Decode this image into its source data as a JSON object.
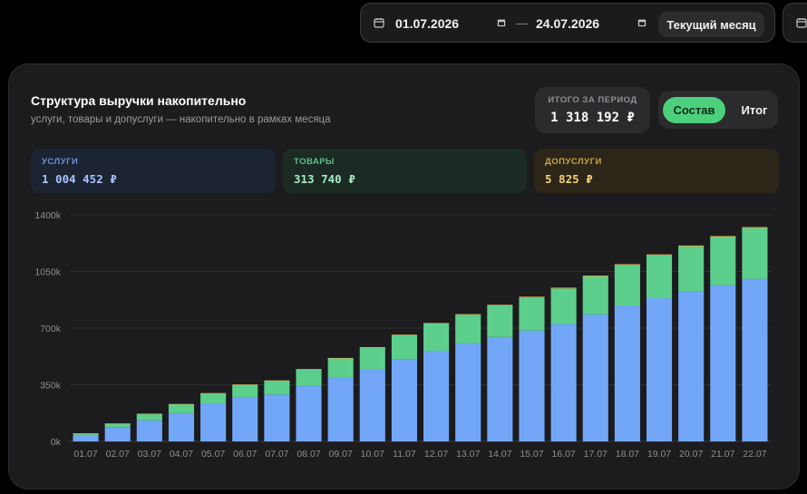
{
  "date_range": {
    "start": "01.07.2026",
    "end": "24.07.2026",
    "separator": "—",
    "preset_label": "Текущий месяц"
  },
  "card": {
    "title": "Структура выручки накопительно",
    "subtitle": "услуги, товары и допуслуги — накопительно в рамках месяца",
    "total_label": "ИТОГО ЗА ПЕРИОД",
    "total_value": "1 318 192 ₽",
    "toggle": {
      "active": "Состав",
      "other": "Итог"
    }
  },
  "stats": [
    {
      "label": "УСЛУГИ",
      "value": "1 004 452 ₽"
    },
    {
      "label": "ТОВАРЫ",
      "value": "313 740 ₽"
    },
    {
      "label": "ДОПУСЛУГИ",
      "value": "5 825 ₽"
    }
  ],
  "colors": {
    "services": "#72a6f7",
    "goods": "#5ccf8d",
    "extras": "#e3b74f",
    "accent": "#4cd07d"
  },
  "chart_data": {
    "type": "bar",
    "stacked": true,
    "categories": [
      "01.07",
      "02.07",
      "03.07",
      "04.07",
      "05.07",
      "06.07",
      "07.07",
      "08.07",
      "09.07",
      "10.07",
      "11.07",
      "12.07",
      "13.07",
      "14.07",
      "15.07",
      "16.07",
      "17.07",
      "18.07",
      "19.07",
      "20.07",
      "21.07",
      "22.07"
    ],
    "series": [
      {
        "name": "УСЛУГИ",
        "values": [
          40000,
          88000,
          130000,
          175000,
          235000,
          275000,
          290000,
          345000,
          395000,
          445000,
          505000,
          560000,
          605000,
          645000,
          685000,
          725000,
          785000,
          840000,
          885000,
          925000,
          965000,
          1004452
        ]
      },
      {
        "name": "ТОВАРЫ",
        "values": [
          10000,
          22000,
          40000,
          55000,
          62000,
          75000,
          85000,
          100000,
          118000,
          135000,
          152000,
          168000,
          178000,
          195000,
          205000,
          220000,
          235000,
          250000,
          265000,
          280000,
          298000,
          313740
        ]
      },
      {
        "name": "ДОПУСЛУГИ",
        "values": [
          300,
          600,
          900,
          1200,
          1500,
          1800,
          2000,
          2300,
          2600,
          2800,
          3100,
          3400,
          3600,
          3900,
          4100,
          4400,
          4700,
          5000,
          5200,
          5400,
          5600,
          5825
        ]
      }
    ],
    "yticks": [
      0,
      350000,
      700000,
      1050000,
      1400000
    ],
    "ytick_labels": [
      "0k",
      "350k",
      "700k",
      "1050k",
      "1400k"
    ],
    "ylim": [
      0,
      1400000
    ],
    "grid": true
  }
}
